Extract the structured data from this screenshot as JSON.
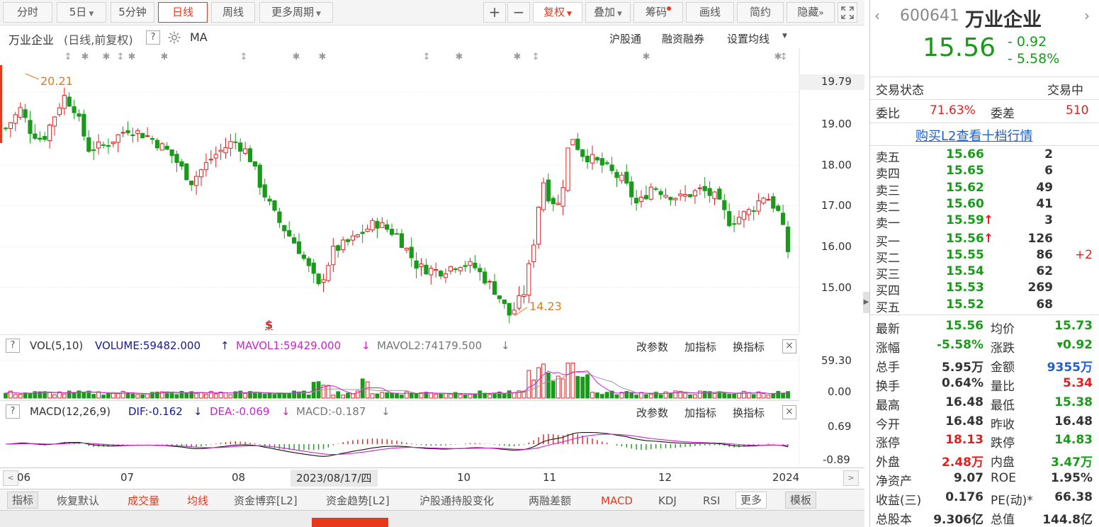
{
  "toolbar": {
    "tabs": [
      "分时",
      "5日",
      "5分钟",
      "日线",
      "周线",
      "更多周期"
    ],
    "right_buttons": [
      "+",
      "−",
      "复权",
      "叠加",
      "筹码",
      "画线",
      "简约",
      "隐藏"
    ]
  },
  "chart_header": {
    "title": "万业企业",
    "subtitle": "(日线,前复权)",
    "help": "?",
    "ma": "MA",
    "links": [
      "沪股通",
      "融资融券",
      "设置均线"
    ]
  },
  "price_axis": [
    "19.79",
    "19.00",
    "18.00",
    "17.00",
    "16.00",
    "15.00"
  ],
  "annotations": {
    "high": "20.21",
    "low": "14.23",
    "marker": "$"
  },
  "volume_panel": {
    "label": "VOL(5,10)",
    "volume": "VOLUME:59482.000",
    "mavol1": "MAVOL1:59429.000",
    "mavol2": "MAVOL2:74179.500",
    "up_arrow": "↑",
    "down_arrow": "↓",
    "axis": [
      "59.30",
      "0.00"
    ],
    "actions": [
      "改参数",
      "加指标",
      "换指标"
    ]
  },
  "macd_panel": {
    "label": "MACD(12,26,9)",
    "dif": "DIF:-0.162",
    "dea": "DEA:-0.069",
    "macd": "MACD:-0.187",
    "down_arrow": "↓",
    "axis": [
      "0.69",
      "-0.89"
    ],
    "actions": [
      "改参数",
      "加指标",
      "换指标"
    ]
  },
  "x_axis": {
    "labels": [
      "06",
      "07",
      "08",
      "10",
      "11",
      "12",
      "2024"
    ],
    "cursor_date": "2023/08/17/四"
  },
  "bottom_tabs": [
    "指标",
    "恢复默认",
    "成交量",
    "均线",
    "资金博弈[L2]",
    "资金趋势[L2]",
    "沪股通持股变化",
    "两融差额",
    "MACD",
    "KDJ",
    "RSI",
    "更多",
    "模板"
  ],
  "quote": {
    "code": "600641",
    "name": "万业企业",
    "price": "15.56",
    "change": "- 0.92",
    "change_pct": "- 5.58%",
    "status_label": "交易状态",
    "status_value": "交易中",
    "weibi_label": "委比",
    "weibi_value": "71.63%",
    "weicha_label": "委差",
    "weicha_value": "510",
    "l2_link": "购买L2查看十档行情",
    "asks": [
      {
        "label": "卖五",
        "price": "15.66",
        "vol": "2",
        "arrow": ""
      },
      {
        "label": "卖四",
        "price": "15.65",
        "vol": "6",
        "arrow": ""
      },
      {
        "label": "卖三",
        "price": "15.62",
        "vol": "49",
        "arrow": ""
      },
      {
        "label": "卖二",
        "price": "15.60",
        "vol": "41",
        "arrow": ""
      },
      {
        "label": "卖一",
        "price": "15.59",
        "vol": "3",
        "arrow": "↑"
      }
    ],
    "bids": [
      {
        "label": "买一",
        "price": "15.56",
        "vol": "126",
        "arrow": "↑",
        "extra": ""
      },
      {
        "label": "买二",
        "price": "15.55",
        "vol": "86",
        "arrow": "",
        "extra": "+2"
      },
      {
        "label": "买三",
        "price": "15.54",
        "vol": "62",
        "arrow": "",
        "extra": ""
      },
      {
        "label": "买四",
        "price": "15.53",
        "vol": "269",
        "arrow": "",
        "extra": ""
      },
      {
        "label": "买五",
        "price": "15.52",
        "vol": "68",
        "arrow": "",
        "extra": ""
      }
    ],
    "stats": [
      {
        "l1": "最新",
        "v1": "15.56",
        "c1": "grn",
        "l2": "均价",
        "v2": "15.73",
        "c2": "grn"
      },
      {
        "l1": "涨幅",
        "v1": "-5.58%",
        "c1": "grn",
        "l2": "涨跌",
        "v2": "▾0.92",
        "c2": "grn"
      },
      {
        "l1": "总手",
        "v1": "5.95万",
        "c1": "",
        "l2": "金额",
        "v2": "9355万",
        "c2": "blue"
      },
      {
        "l1": "换手",
        "v1": "0.64%",
        "c1": "",
        "l2": "量比",
        "v2": "5.34",
        "c2": "red"
      },
      {
        "l1": "最高",
        "v1": "16.48",
        "c1": "",
        "l2": "最低",
        "v2": "15.38",
        "c2": "grn"
      },
      {
        "l1": "今开",
        "v1": "16.48",
        "c1": "",
        "l2": "昨收",
        "v2": "16.48",
        "c2": ""
      },
      {
        "l1": "涨停",
        "v1": "18.13",
        "c1": "red",
        "l2": "跌停",
        "v2": "14.83",
        "c2": "grn"
      },
      {
        "l1": "外盘",
        "v1": "2.48万",
        "c1": "red",
        "l2": "内盘",
        "v2": "3.47万",
        "c2": "grn"
      },
      {
        "l1": "净资产",
        "v1": "9.07",
        "c1": "",
        "l2": "ROE",
        "v2": "1.95%",
        "c2": ""
      },
      {
        "l1": "收益(三)",
        "v1": "0.176",
        "c1": "",
        "l2": "PE(动)*",
        "v2": "66.38",
        "c2": ""
      },
      {
        "l1": "总股本",
        "v1": "9.306亿",
        "c1": "",
        "l2": "总值",
        "v2": "144.8亿",
        "c2": ""
      }
    ]
  },
  "colors": {
    "up": "#e02020",
    "down": "#1a9a1a",
    "accent": "#e8391d",
    "ma_orange": "#e8a040"
  }
}
